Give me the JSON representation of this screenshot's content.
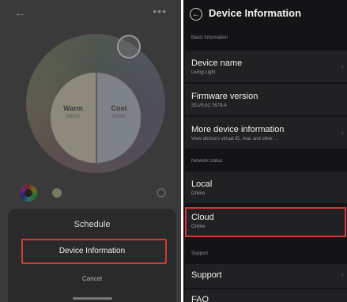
{
  "left_panel": {
    "color_wheel": {
      "warm_label": "Warm",
      "warm_sub": "White",
      "cool_label": "Cool",
      "cool_sub": "White"
    },
    "sheet": {
      "schedule_label": "Schedule",
      "device_info_label": "Device Information",
      "cancel_label": "Cancel"
    }
  },
  "right_panel": {
    "title": "Device Information",
    "sections": {
      "basic": "Basic Information",
      "network": "Network status",
      "support": "Support"
    },
    "rows": {
      "device_name": {
        "title": "Device name",
        "sub": "Living Light"
      },
      "firmware": {
        "title": "Firmware version",
        "sub": "35.V9.62.7679-A"
      },
      "more_info": {
        "title": "More device information",
        "sub": "View device's virtual ID, mac and other ..."
      },
      "local": {
        "title": "Local",
        "sub": "Online"
      },
      "cloud": {
        "title": "Cloud",
        "sub": "Online"
      },
      "support": {
        "title": "Support"
      },
      "faq": {
        "title": "FAQ"
      }
    }
  },
  "colors": {
    "highlight": "#d23a3a",
    "dark_bg": "#141416"
  }
}
